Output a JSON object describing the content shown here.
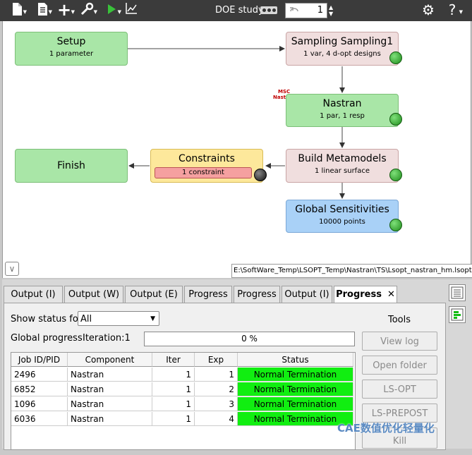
{
  "toolbar": {
    "study_label": "DOE study",
    "iteration_value": "1",
    "icons": [
      "new-file-icon",
      "document-icon",
      "add-icon",
      "wrench-icon",
      "run-icon",
      "chart-icon",
      "gear-icon",
      "help-icon"
    ]
  },
  "workflow": {
    "setup": {
      "title": "Setup",
      "subtitle": "1 parameter"
    },
    "sampling": {
      "title": "Sampling Sampling1",
      "subtitle": "1 var, 4 d-opt designs"
    },
    "nastran": {
      "title": "Nastran",
      "subtitle": "1 par, 1 resp",
      "logo_line1": "MSC",
      "logo_line2": "Nastran"
    },
    "build": {
      "title": "Build Metamodels",
      "subtitle": "1 linear surface"
    },
    "constraints": {
      "title": "Constraints",
      "subtitle": "1 constraint"
    },
    "finish": {
      "title": "Finish"
    },
    "global": {
      "title": "Global Sensitivities",
      "subtitle": "10000 points"
    },
    "path": "E:\\SoftWare_Temp\\LSOPT_Temp\\Nastran\\TS\\Lsopt_nastran_hm.lsopt"
  },
  "tabs": [
    {
      "label": "Output (I)"
    },
    {
      "label": "Output (W)"
    },
    {
      "label": "Output (E)"
    },
    {
      "label": "Progress"
    },
    {
      "label": "Progress"
    },
    {
      "label": "Output (I)"
    },
    {
      "label": "Progress",
      "close": "✕"
    }
  ],
  "progress_panel": {
    "show_status_label": "Show status for:",
    "show_status_value": "All",
    "global_progress_label": "Global progress",
    "iteration_label": "Iteration:1",
    "progress_text": "0 %",
    "columns": [
      "Job ID/PID",
      "Component",
      "Iter",
      "Exp",
      "Status"
    ],
    "rows": [
      {
        "id": "2496",
        "component": "Nastran",
        "iter": "1",
        "exp": "1",
        "status": "Normal Termination"
      },
      {
        "id": "6852",
        "component": "Nastran",
        "iter": "1",
        "exp": "2",
        "status": "Normal Termination"
      },
      {
        "id": "1096",
        "component": "Nastran",
        "iter": "1",
        "exp": "3",
        "status": "Normal Termination"
      },
      {
        "id": "6036",
        "component": "Nastran",
        "iter": "1",
        "exp": "4",
        "status": "Normal Termination"
      }
    ],
    "status_color": "#11ee11"
  },
  "tools": {
    "title": "Tools",
    "buttons": [
      "View log",
      "Open folder",
      "LS-OPT",
      "LS-PREPOST",
      "Kill"
    ]
  },
  "watermark": "CAE数值优化轻量化"
}
